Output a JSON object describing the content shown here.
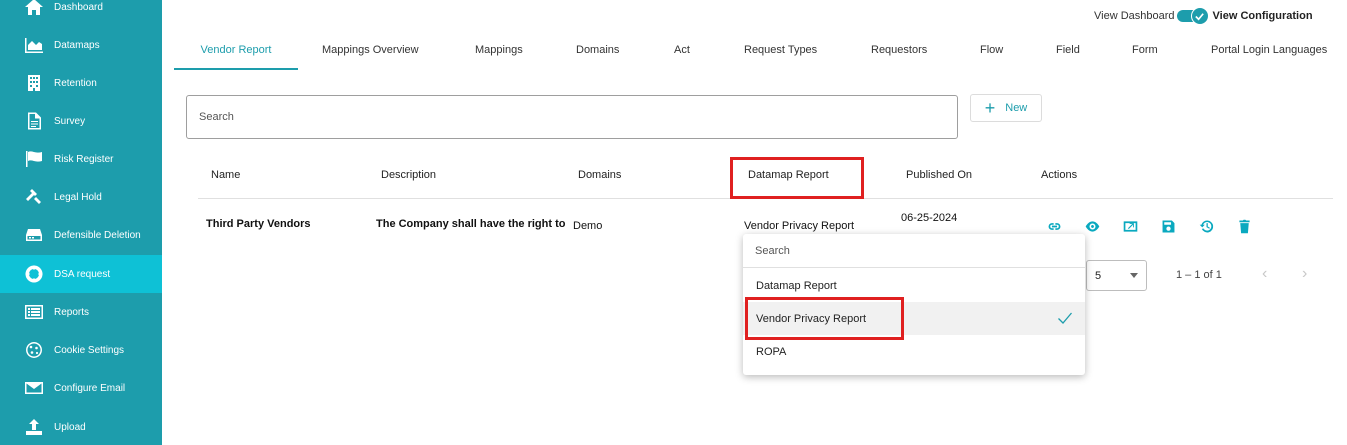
{
  "sidebar": {
    "items": [
      {
        "label": "Dashboard",
        "icon": "home-icon"
      },
      {
        "label": "Datamaps",
        "icon": "area-chart-icon"
      },
      {
        "label": "Retention",
        "icon": "building-icon"
      },
      {
        "label": "Survey",
        "icon": "document-icon"
      },
      {
        "label": "Risk Register",
        "icon": "flag-icon"
      },
      {
        "label": "Legal Hold",
        "icon": "gavel-icon"
      },
      {
        "label": "Defensible Deletion",
        "icon": "hard-drive-icon"
      },
      {
        "label": "DSA request",
        "icon": "lifebuoy-icon"
      },
      {
        "label": "Reports",
        "icon": "list-icon"
      },
      {
        "label": "Cookie Settings",
        "icon": "cookie-icon"
      },
      {
        "label": "Configure Email",
        "icon": "envelope-icon"
      },
      {
        "label": "Upload",
        "icon": "upload-icon"
      }
    ],
    "active_index": 7
  },
  "view_toggle": {
    "left_label": "View Dashboard",
    "right_label": "View Configuration",
    "state": "View Configuration"
  },
  "tabs": [
    {
      "label": "Vendor Report",
      "active": true
    },
    {
      "label": "Mappings Overview"
    },
    {
      "label": "Mappings"
    },
    {
      "label": "Domains"
    },
    {
      "label": "Act"
    },
    {
      "label": "Request Types"
    },
    {
      "label": "Requestors"
    },
    {
      "label": "Flow"
    },
    {
      "label": "Field"
    },
    {
      "label": "Form"
    },
    {
      "label": "Portal Login Languages"
    }
  ],
  "search": {
    "placeholder": "Search"
  },
  "new_button": {
    "label": "New"
  },
  "table": {
    "columns": [
      "Name",
      "Description",
      "Domains",
      "Datamap Report",
      "Published On",
      "Actions"
    ],
    "rows": [
      {
        "name": "Third Party Vendors",
        "description": "The Company shall have the right to",
        "domains": "Demo",
        "datamap_report": "Vendor Privacy Report",
        "published_on": "06-25-2024",
        "actions": [
          "link-icon",
          "eye-icon",
          "open-external-icon",
          "save-icon",
          "history-icon",
          "trash-icon"
        ]
      }
    ]
  },
  "pagination": {
    "page_size": "5",
    "range": "1 – 1 of 1"
  },
  "dropdown": {
    "search_placeholder": "Search",
    "options": [
      "Datamap Report",
      "Vendor Privacy Report",
      "ROPA"
    ],
    "selected": "Vendor Privacy Report"
  },
  "colors": {
    "sidebar_bg": "#1d9dac",
    "sidebar_active": "#0ec1d6",
    "accent": "#1d9dac",
    "action_icon": "#0aa9bf",
    "highlight_box": "#e02020"
  }
}
